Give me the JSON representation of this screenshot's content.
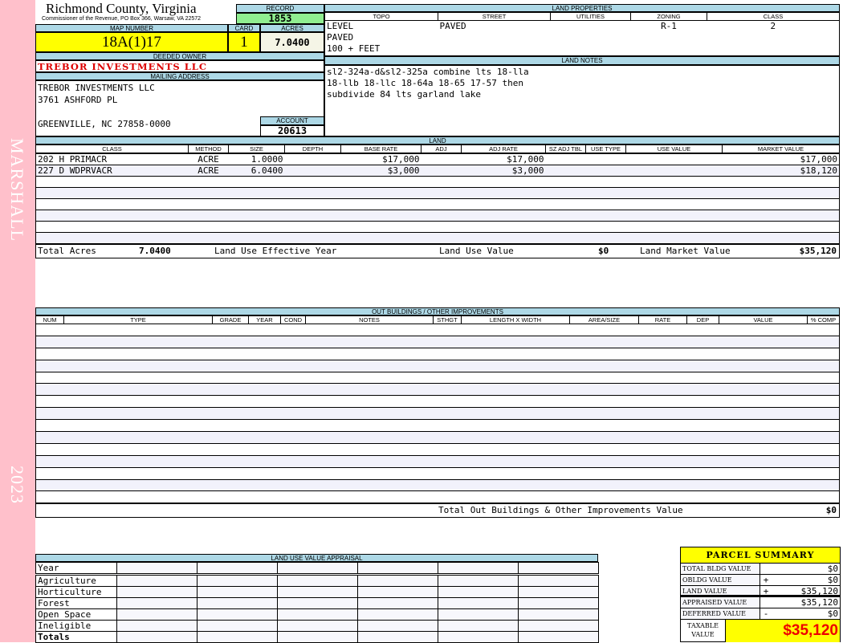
{
  "side": {
    "district": "MARSHALL",
    "year": "2023"
  },
  "header": {
    "title": "Richmond County, Virginia",
    "subtitle": "Commissioner of the Revenue, PO Box 366, Warsaw, VA 22572",
    "record_label": "RECORD",
    "record": "1853"
  },
  "parcel": {
    "map_label": "MAP NUMBER",
    "map": "18A(1)17",
    "card_label": "CARD",
    "card": "1",
    "acres_label": "ACRES",
    "acres": "7.0400"
  },
  "owner": {
    "label": "DEEDED OWNER",
    "name": "TREBOR INVESTMENTS LLC",
    "mail_label": "MAILING ADDRESS",
    "address": [
      "TREBOR INVESTMENTS LLC",
      "3761 ASHFORD PL",
      "",
      "GREENVILLE, NC 27858-0000"
    ],
    "account_label": "ACCOUNT",
    "account": "20613"
  },
  "land_properties": {
    "label": "LAND PROPERTIES",
    "columns": [
      "TOPO",
      "STREET",
      "UTILITIES",
      "ZONING",
      "CLASS"
    ],
    "topo": [
      "LEVEL",
      "PAVED",
      "100 + FEET"
    ],
    "street": "PAVED",
    "utilities": "",
    "zoning": "R-1",
    "class": "2"
  },
  "land_notes": {
    "label": "LAND NOTES",
    "lines": [
      "sl2-324a-d&sl2-325a combine lts 18-lla",
      "18-llb 18-llc 18-64a 18-65 17-57 then",
      "subdivide 84 lts garland lake"
    ]
  },
  "land": {
    "label": "LAND",
    "columns": [
      "CLASS",
      "METHOD",
      "SIZE",
      "DEPTH",
      "BASE RATE",
      "ADJ",
      "ADJ RATE",
      "SZ ADJ TBL",
      "USE TYPE",
      "USE VALUE",
      "MARKET VALUE"
    ],
    "rows": [
      [
        "202 H PRIMACR",
        "ACRE",
        "1.0000",
        "",
        "$17,000",
        "",
        "$17,000",
        "",
        "",
        "",
        "$17,000"
      ],
      [
        "227 D WDPRVACR",
        "ACRE",
        "6.0400",
        "",
        "$3,000",
        "",
        "$3,000",
        "",
        "",
        "",
        "$18,120"
      ]
    ],
    "totals": {
      "acres_label": "Total Acres",
      "acres": "7.0400",
      "eff_year_label": "Land Use Effective Year",
      "use_value_label": "Land Use Value",
      "use_value": "$0",
      "market_label": "Land Market Value",
      "market": "$35,120"
    }
  },
  "outbuildings": {
    "label": "OUT BUILDINGS / OTHER IMPROVEMENTS",
    "columns": [
      "NUM",
      "TYPE",
      "GRADE",
      "YEAR",
      "COND",
      "NOTES",
      "STHGT",
      "LENGTH X WIDTH",
      "AREA/SIZE",
      "RATE",
      "DEP",
      "VALUE",
      "% COMP"
    ],
    "total_label": "Total Out Buildings & Other Improvements Value",
    "total": "$0"
  },
  "land_use": {
    "label": "LAND USE VALUE APPRAISAL",
    "year_label": "Year",
    "rows": [
      "Agriculture",
      "Horticulture",
      "Forest",
      "Open Space",
      "Ineligible"
    ],
    "totals_label": "Totals"
  },
  "summary": {
    "title": "PARCEL SUMMARY",
    "rows": [
      {
        "label": "TOTAL BLDG VALUE",
        "op": "",
        "value": "$0"
      },
      {
        "label": "OBLDG VALUE",
        "op": "+",
        "value": "$0"
      },
      {
        "label": "LAND VALUE",
        "op": "+",
        "value": "$35,120"
      },
      {
        "label": "APPRAISED VALUE",
        "op": "",
        "value": "$35,120"
      },
      {
        "label": "DEFERRED VALUE",
        "op": "-",
        "value": "$0"
      }
    ],
    "taxable_label": "TAXABLE VALUE",
    "taxable": "$35,120"
  },
  "colors": {
    "header_bg": "#add8e6",
    "record_bg": "#90ee90",
    "highlight": "#ffff00",
    "owner_red": "#dd0000",
    "side_pink": "#ffc0cb"
  }
}
